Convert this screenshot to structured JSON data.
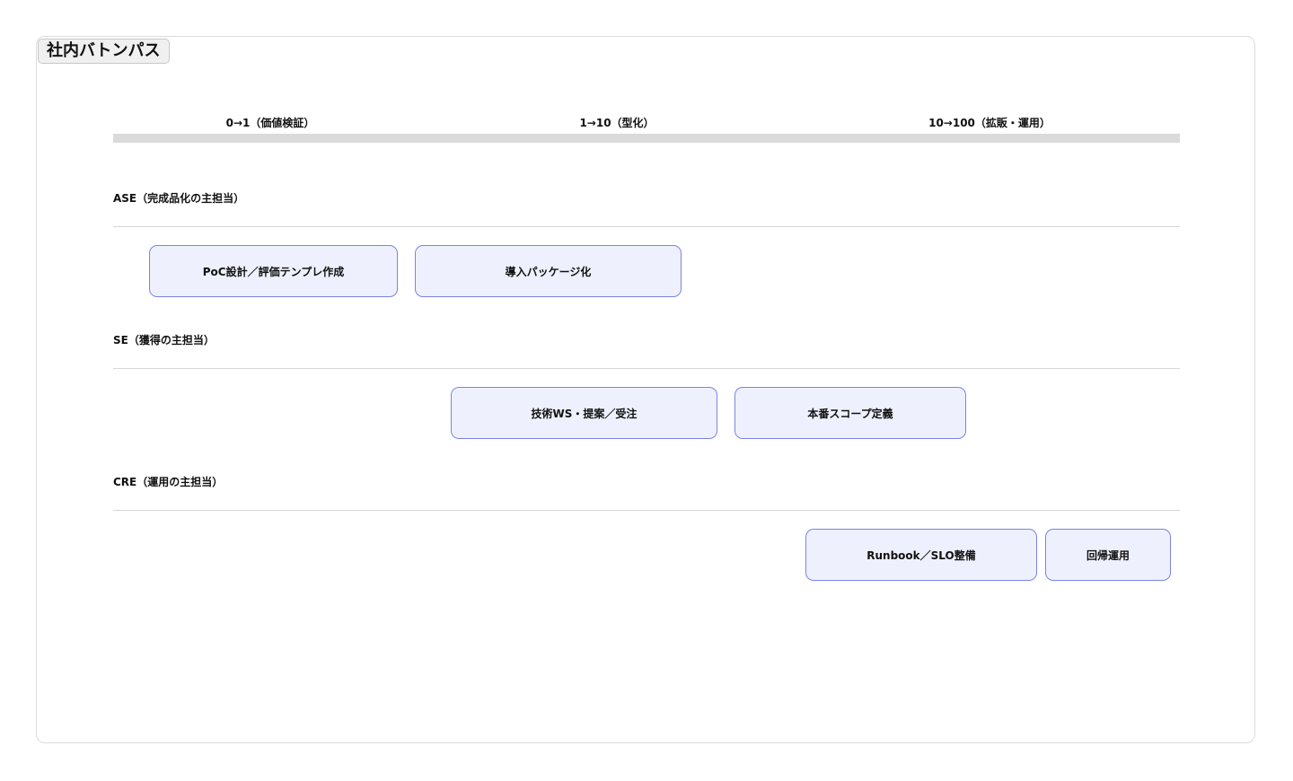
{
  "title": "社内バトンパス",
  "phases": [
    "0→1（価値検証）",
    "1→10（型化）",
    "10→100（拡販・運用）"
  ],
  "lanes": [
    {
      "label": "ASE（完成品化の主担当）",
      "tasks": [
        "PoC設計／評価テンプレ作成",
        "導入パッケージ化"
      ]
    },
    {
      "label": "SE（獲得の主担当）",
      "tasks": [
        "技術WS・提案／受注",
        "本番スコープ定義"
      ]
    },
    {
      "label": "CRE（運用の主担当）",
      "tasks": [
        "Runbook／SLO整備",
        "回帰運用"
      ]
    }
  ],
  "colors": {
    "task_border": "#7b83e6",
    "task_fill": "#eef1fd",
    "phase_bar": "#dadada"
  }
}
